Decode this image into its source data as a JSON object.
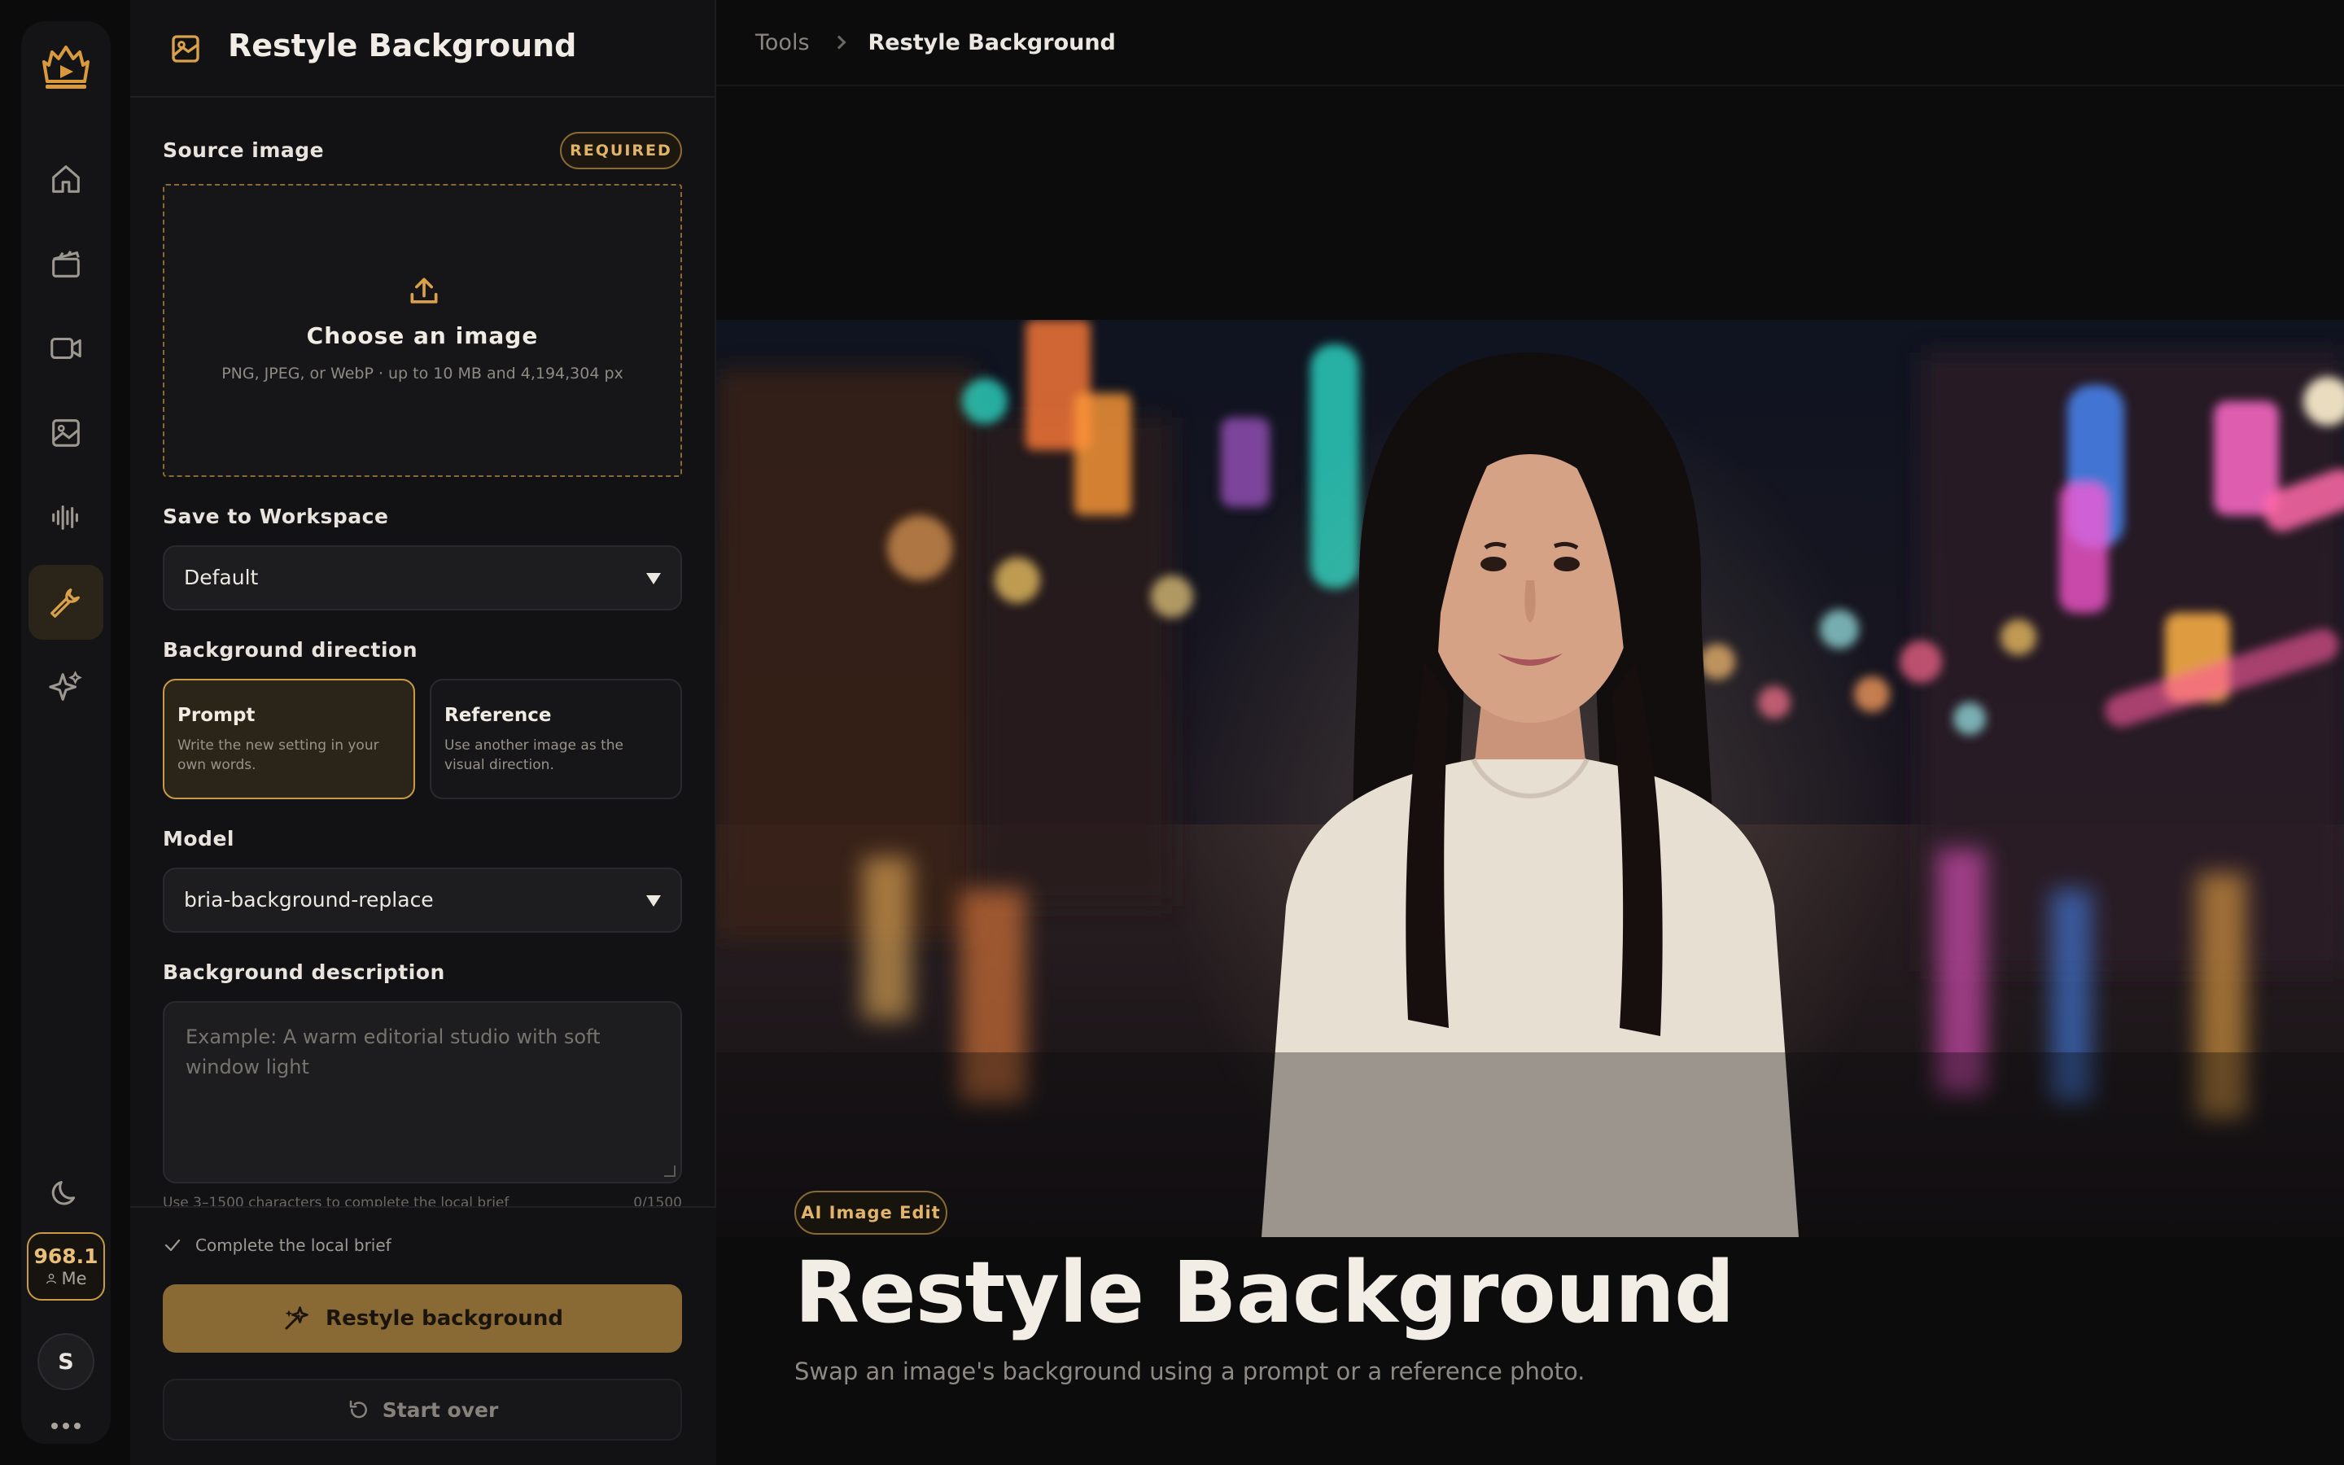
{
  "rail": {
    "items": [
      "home",
      "clapperboard",
      "video",
      "image",
      "audio",
      "tools",
      "sparkles"
    ],
    "active": "tools",
    "credits": "968.1",
    "user_label": "Me",
    "avatar_initial": "S"
  },
  "panel": {
    "title": "Restyle Background",
    "source_label": "Source image",
    "required_badge": "REQUIRED",
    "upload_title": "Choose an image",
    "upload_hint": "PNG, JPEG, or WebP · up to 10 MB and 4,194,304 px",
    "workspace_label": "Save to Workspace",
    "workspace_value": "Default",
    "direction_label": "Background direction",
    "options": [
      {
        "title": "Prompt",
        "desc": "Write the new setting in your own words.",
        "selected": true
      },
      {
        "title": "Reference",
        "desc": "Use another image as the visual direction.",
        "selected": false
      }
    ],
    "model_label": "Model",
    "model_value": "bria-background-replace",
    "description_label": "Background description",
    "description_placeholder": "Example: A warm editorial studio with soft window light",
    "helper_text": "Use 3–1500 characters to complete the local brief",
    "char_count": "0/1500",
    "checklist_item": "Complete the local brief",
    "primary_button": "Restyle background",
    "secondary_button": "Start over"
  },
  "main": {
    "breadcrumb": [
      "Tools",
      "Restyle Background"
    ],
    "badge": "AI Image Edit",
    "title": "Restyle Background",
    "subtitle": "Swap an image's background using a prompt or a reference photo."
  },
  "colors": {
    "accent": "#c99a45",
    "accent_dark": "#8a6a34",
    "background": "#0b0b0c",
    "panel": "#121214"
  }
}
